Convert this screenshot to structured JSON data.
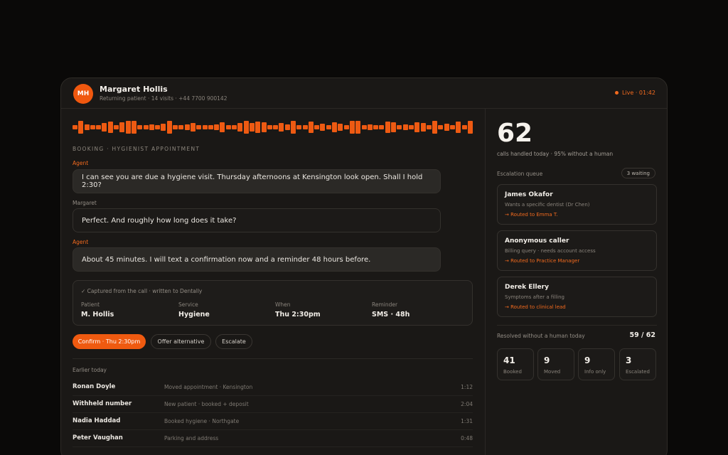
{
  "header": {
    "initials": "MH",
    "name": "Margaret Hollis",
    "subtitle": "Returning patient · 14 visits · +44 7700 900142",
    "live": "Live · 01:42"
  },
  "call": {
    "section_label": "BOOKING · HYGIENIST APPOINTMENT",
    "messages": [
      {
        "speaker": "Agent",
        "text": "I can see you are due a hygiene visit. Thursday afternoons at Kensington look open. Shall I hold 2:30?"
      },
      {
        "speaker": "Margaret",
        "text": "Perfect. And roughly how long does it take?"
      },
      {
        "speaker": "Agent",
        "text": "About 45 minutes. I will text a confirmation now and a reminder 48 hours before."
      }
    ]
  },
  "captured": {
    "title": "Captured from the call · written to Dentally",
    "fields": [
      {
        "label": "Patient",
        "value": "M. Hollis"
      },
      {
        "label": "Service",
        "value": "Hygiene"
      },
      {
        "label": "When",
        "value": "Thu 2:30pm"
      },
      {
        "label": "Reminder",
        "value": "SMS · 48h"
      }
    ]
  },
  "actions": {
    "confirm": "Confirm · Thu 2:30pm",
    "alternative": "Offer alternative",
    "escalate": "Escalate"
  },
  "earlier": {
    "label": "Earlier today",
    "rows": [
      {
        "name": "Ronan Doyle",
        "note": "Moved appointment · Kensington",
        "time": "1:12"
      },
      {
        "name": "Withheld number",
        "note": "New patient · booked + deposit",
        "time": "2:04"
      },
      {
        "name": "Nadia Haddad",
        "note": "Booked hygiene · Northgate",
        "time": "1:31"
      },
      {
        "name": "Peter Vaughan",
        "note": "Parking and address",
        "time": "0:48"
      }
    ]
  },
  "stats": {
    "handled": "62",
    "handled_sub": "calls handled today · 95% without a human",
    "queue_label": "Escalation queue",
    "waiting": "3 waiting",
    "queue": [
      {
        "name": "James Okafor",
        "desc": "Wants a specific dentist (Dr Chen)",
        "route": "→ Routed to Emma T."
      },
      {
        "name": "Anonymous caller",
        "desc": "Billing query · needs account access",
        "route": "→ Routed to Practice Manager"
      },
      {
        "name": "Derek Ellery",
        "desc": "Symptoms after a filling",
        "route": "→ Routed to clinical lead"
      }
    ],
    "resolved_label": "Resolved without a human today",
    "resolved_value": "59 / 62",
    "breakdown": [
      {
        "num": "41",
        "label": "Booked"
      },
      {
        "num": "9",
        "label": "Moved"
      },
      {
        "num": "9",
        "label": "Info only"
      },
      {
        "num": "3",
        "label": "Escalated"
      }
    ]
  },
  "colors": {
    "accent": "#ef5a10",
    "background": "#0a0908",
    "card": "#1a1816"
  }
}
